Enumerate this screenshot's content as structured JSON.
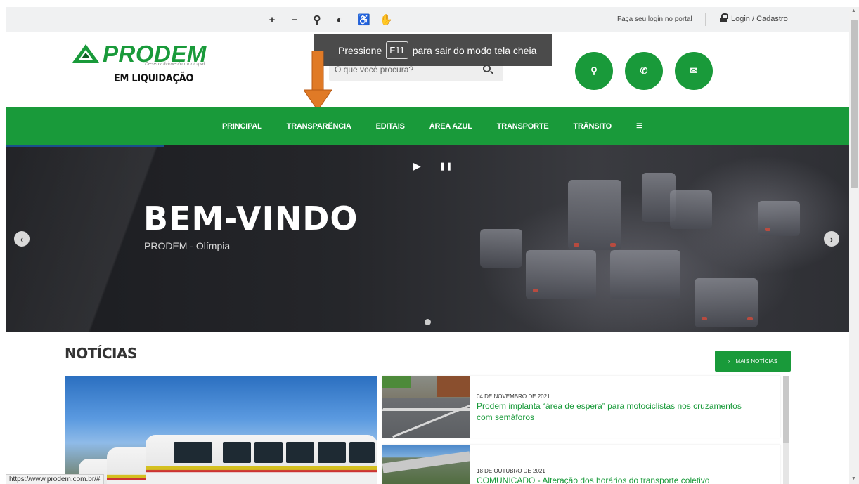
{
  "accessibility": {
    "items": [
      {
        "icon": "zoom-in-icon",
        "glyph": "+"
      },
      {
        "icon": "zoom-out-icon",
        "glyph": "−"
      },
      {
        "icon": "location-icon",
        "glyph": "⚲"
      },
      {
        "icon": "contrast-icon",
        "glyph": "◐"
      },
      {
        "icon": "wheelchair-icon",
        "glyph": "♿"
      },
      {
        "icon": "sign-language-icon",
        "glyph": "✋"
      }
    ]
  },
  "login": {
    "hint": "Faça seu login no portal",
    "link": "Login / Cadastro"
  },
  "logo": {
    "name": "PRODEM",
    "tagline": "Desenvolvimento municipal",
    "subtitle": "EM LIQUIDAÇÃO"
  },
  "search": {
    "placeholder": "O que você procura?"
  },
  "fullscreen_notice": {
    "before": "Pressione",
    "key": "F11",
    "after": "para sair do modo tela cheia"
  },
  "contact_buttons": [
    {
      "icon": "map-marker-icon",
      "glyph": "⚲"
    },
    {
      "icon": "phone-icon",
      "glyph": "✆"
    },
    {
      "icon": "envelope-icon",
      "glyph": "✉"
    }
  ],
  "nav": {
    "items": [
      "PRINCIPAL",
      "TRANSPARÊNCIA",
      "EDITAIS",
      "ÁREA AZUL",
      "TRANSPORTE",
      "TRÂNSITO"
    ],
    "menu_glyph": "≡"
  },
  "hero": {
    "title": "BEM-VINDO",
    "subtitle": "PRODEM - Olímpia",
    "play_glyph": "▶",
    "pause_glyph": "❚❚",
    "prev_glyph": "‹",
    "next_glyph": "›"
  },
  "news": {
    "title": "NOTÍCIAS",
    "more_label": "MAIS NOTÍCIAS",
    "more_glyph": "›",
    "items": [
      {
        "date": "04 DE NOVEMBRO DE 2021",
        "headline": "Prodem implanta “área de espera” para motociclistas nos cruzamentos com semáforos"
      },
      {
        "date": "18 DE OUTUBRO DE 2021",
        "headline": "COMUNICADO - Alteração dos horários do transporte coletivo"
      }
    ]
  },
  "status_bar": {
    "url": "https://www.prodem.com.br/#"
  },
  "colors": {
    "brand_green": "#199a3a",
    "arrow_orange": "#e07a26"
  }
}
